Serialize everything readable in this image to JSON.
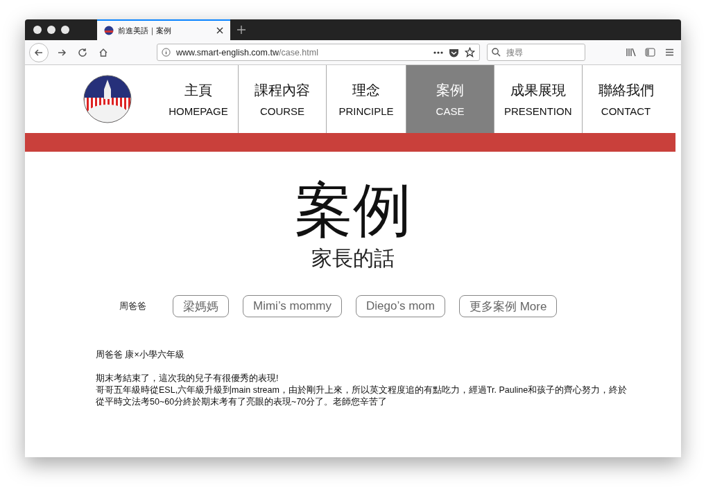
{
  "browser": {
    "tabs": [
      {
        "title": "前進美語｜案例",
        "selected": true
      }
    ],
    "url": {
      "domain": "www.smart-english.com.tw",
      "path": "/case.html"
    },
    "search": {
      "placeholder": "搜尋"
    }
  },
  "nav": {
    "items": [
      {
        "zh": "主頁",
        "en": "HOMEPAGE",
        "selected": false
      },
      {
        "zh": "課程內容",
        "en": "COURSE",
        "selected": false
      },
      {
        "zh": "理念",
        "en": "PRINCIPLE",
        "selected": false
      },
      {
        "zh": "案例",
        "en": "CASE",
        "selected": true
      },
      {
        "zh": "成果展現",
        "en": "PRESENTION",
        "selected": false
      },
      {
        "zh": "聯絡我們",
        "en": "CONTACT",
        "selected": false
      }
    ]
  },
  "hero": {
    "title": "案例",
    "subtitle": "家長的話"
  },
  "cases": [
    {
      "label": "周爸爸",
      "selected": true
    },
    {
      "label": "梁媽媽",
      "selected": false
    },
    {
      "label": "Mimi’s mommy",
      "selected": false
    },
    {
      "label": "Diego’s mom",
      "selected": false
    },
    {
      "label": "更多案例 More",
      "selected": false
    }
  ],
  "story": {
    "heading": "周爸爸 康×小學六年級",
    "lines": [
      "期末考結束了，這次我的兒子有很優秀的表現!",
      "哥哥五年級時從ESL,六年級升級到main stream，由於剛升上來，所以英文程度追的有點吃力，經過Tr. Pauline和孩子的齊心努力，終於",
      "從平時文法考50~60分終於期末考有了亮眼的表現~70分了。老師您辛苦了"
    ]
  }
}
